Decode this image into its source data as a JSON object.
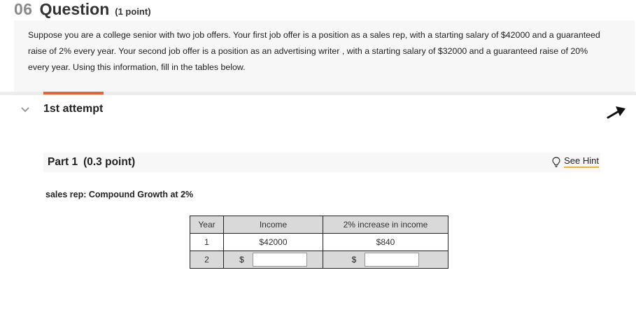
{
  "question": {
    "number": "06",
    "title": "Question",
    "points": "(1 point)",
    "text": "Suppose you are a college senior with two job offers. Your first job offer is a position as a sales rep, with a starting salary of $42000 and a guaranteed raise of 2% every year. Your second job offer is a position as an advertising writer , with a starting salary of $32000 and a guaranteed raise of 20% every year. Using this information, fill in the tables below."
  },
  "attempt": {
    "label": "1st attempt"
  },
  "part": {
    "title": "Part 1",
    "points": "(0.3 point)",
    "hint_label": "See Hint"
  },
  "table": {
    "subtitle": "sales rep: Compound Growth at 2%",
    "headers": [
      "Year",
      "Income",
      "2% increase in income"
    ],
    "rows": [
      {
        "year": "1",
        "income": "$42000",
        "increase": "$840"
      },
      {
        "year": "2",
        "income_prefix": "$",
        "income_value": "",
        "increase_prefix": "$",
        "increase_value": ""
      }
    ]
  },
  "colors": {
    "accent": "#e0653a",
    "hint_underline": "#f0b429",
    "header_bg": "#d9d9d9",
    "panel_bg": "#f7f7f7"
  }
}
